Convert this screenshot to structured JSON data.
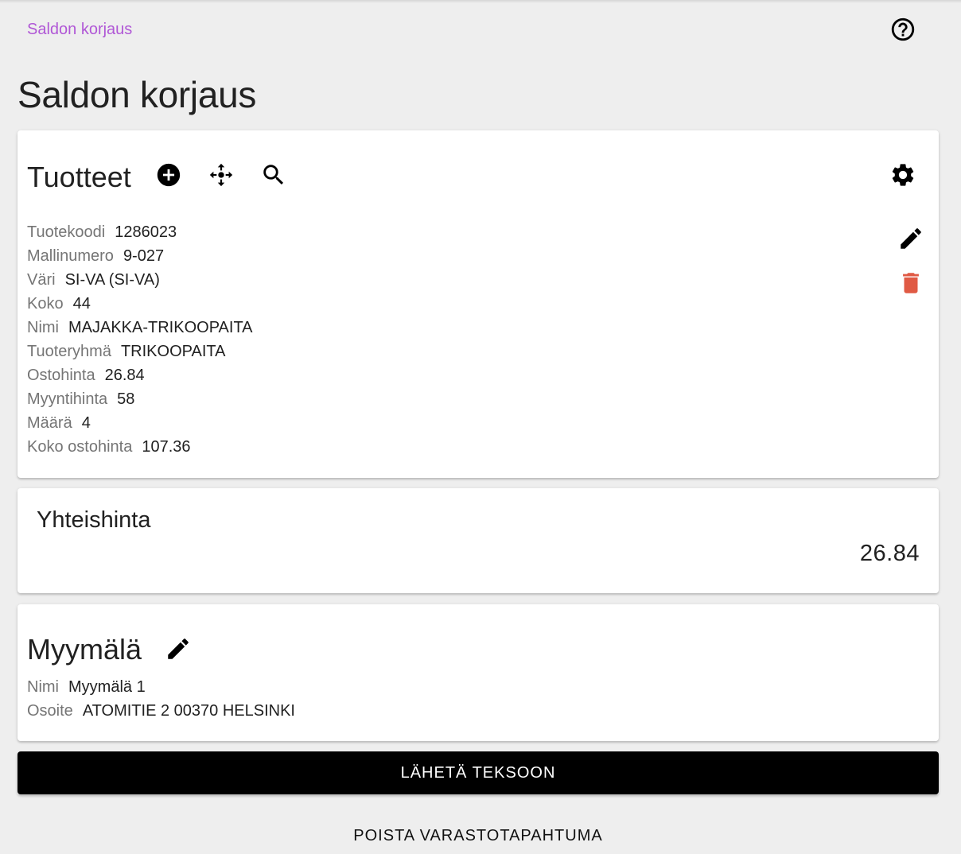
{
  "breadcrumb": {
    "label": "Saldon korjaus"
  },
  "header": {
    "title": "Saldon korjaus"
  },
  "products": {
    "title": "Tuotteet",
    "fields": [
      {
        "label": "Tuotekoodi",
        "value": "1286023"
      },
      {
        "label": "Mallinumero",
        "value": "9-027"
      },
      {
        "label": "Väri",
        "value": "SI-VA (SI-VA)"
      },
      {
        "label": "Koko",
        "value": "44"
      },
      {
        "label": "Nimi",
        "value": "MAJAKKA-TRIKOOPAITA"
      },
      {
        "label": "Tuoteryhmä",
        "value": "TRIKOOPAITA"
      },
      {
        "label": "Ostohinta",
        "value": "26.84"
      },
      {
        "label": "Myyntihinta",
        "value": "58"
      },
      {
        "label": "Määrä",
        "value": "4"
      },
      {
        "label": "Koko ostohinta",
        "value": "107.36"
      }
    ]
  },
  "total": {
    "label": "Yhteishinta",
    "value": "26.84"
  },
  "store": {
    "title": "Myymälä",
    "fields": [
      {
        "label": "Nimi",
        "value": "Myymälä 1"
      },
      {
        "label": "Osoite",
        "value": "ATOMITIE 2 00370 HELSINKI"
      }
    ]
  },
  "actions": {
    "send_label": "LÄHETÄ TEKSOON",
    "delete_label": "POISTA VARASTOTAPAHTUMA"
  },
  "icons": {
    "help": "help-circle-icon",
    "add": "add-circle-icon",
    "move": "move-icon",
    "search": "search-icon",
    "settings": "gear-icon",
    "edit": "pencil-icon",
    "delete": "trash-icon"
  },
  "colors": {
    "background": "#eeeeee",
    "card": "#ffffff",
    "breadcrumb": "#b057d6",
    "delete_icon": "#e05a44",
    "primary_button": "#000000",
    "label_text": "#757575"
  }
}
